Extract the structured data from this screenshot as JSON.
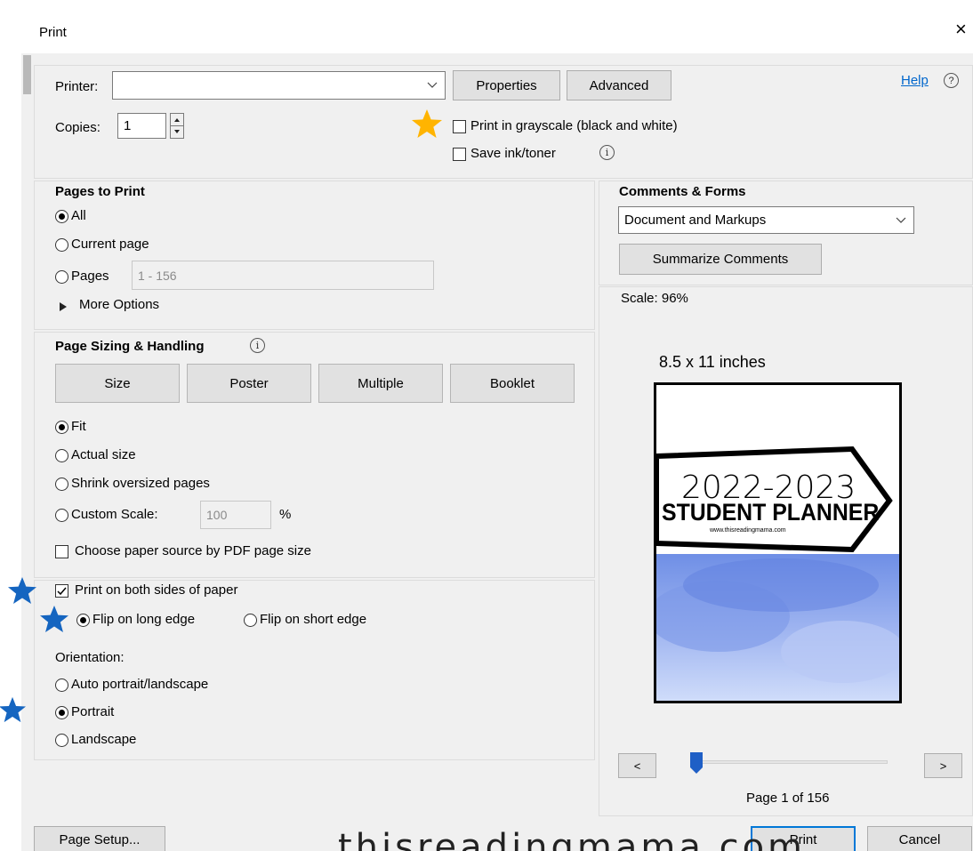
{
  "window": {
    "title": "Print",
    "close_glyph": "×"
  },
  "printer": {
    "label": "Printer:",
    "selected": "",
    "properties_label": "Properties",
    "advanced_label": "Advanced",
    "help_label": "Help",
    "help_icon": "?"
  },
  "copies": {
    "label": "Copies:",
    "value": "1"
  },
  "options": {
    "grayscale_label": "Print in grayscale (black and white)",
    "grayscale_checked": false,
    "save_ink_label": "Save ink/toner",
    "save_ink_checked": false
  },
  "pages_to_print": {
    "heading": "Pages to Print",
    "all_label": "All",
    "current_label": "Current page",
    "pages_label": "Pages",
    "pages_value": "1 - 156",
    "more_options_label": "More Options",
    "selected": "All"
  },
  "sizing": {
    "heading": "Page Sizing & Handling",
    "tabs": [
      "Size",
      "Poster",
      "Multiple",
      "Booklet"
    ],
    "fit_label": "Fit",
    "actual_label": "Actual size",
    "shrink_label": "Shrink oversized pages",
    "custom_label": "Custom Scale:",
    "custom_value": "100",
    "percent_label": "%",
    "paper_source_label": "Choose paper source by PDF page size",
    "selected": "Fit"
  },
  "duplex": {
    "both_sides_label": "Print on both sides of paper",
    "both_sides_checked": true,
    "long_edge_label": "Flip on long edge",
    "short_edge_label": "Flip on short edge",
    "selected": "Flip on long edge"
  },
  "orientation": {
    "label": "Orientation:",
    "auto_label": "Auto portrait/landscape",
    "portrait_label": "Portrait",
    "landscape_label": "Landscape",
    "selected": "Portrait"
  },
  "comments_forms": {
    "heading": "Comments & Forms",
    "selected": "Document and Markups",
    "summarize_label": "Summarize Comments"
  },
  "preview": {
    "scale_label": "Scale: 96%",
    "size_caption": "8.5 x 11 inches",
    "page_year": "2022-2023",
    "page_title": "STUDENT PLANNER",
    "page_url": "www.thisreadingmama.com",
    "prev_label": "<",
    "next_label": ">",
    "page_indicator": "Page 1 of 156",
    "slider_position": 0.0
  },
  "footer": {
    "page_setup_label": "Page Setup...",
    "print_label": "Print",
    "cancel_label": "Cancel"
  },
  "overlay": {
    "watermark_text": "thisreadingmama.com",
    "accent_star_color": "#ffb400",
    "marker_star_color": "#1565c0"
  }
}
